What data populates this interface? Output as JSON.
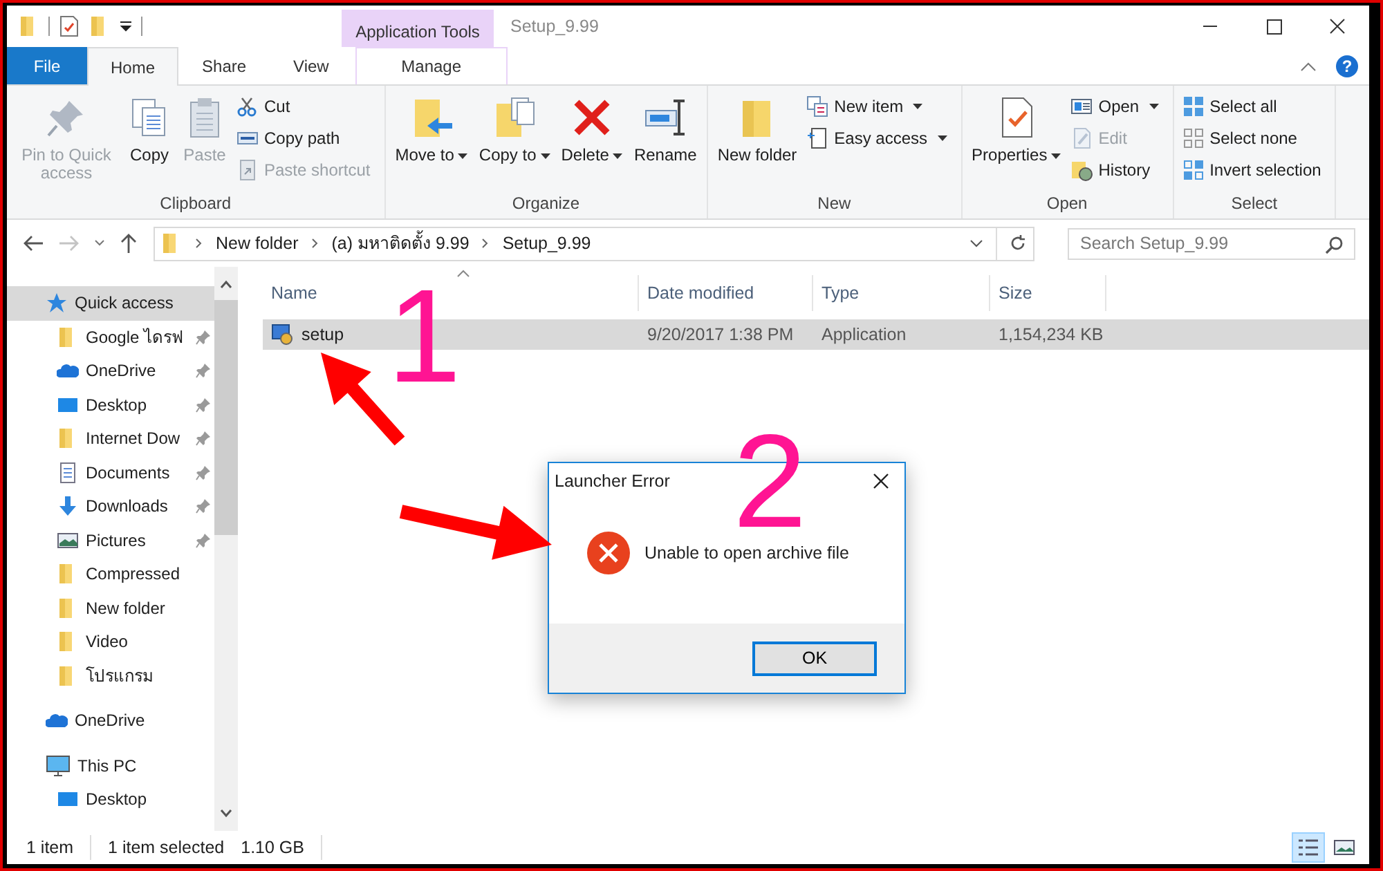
{
  "title_bar": {
    "contextual_tab": "Application Tools",
    "title": "Setup_9.99"
  },
  "ribbon_tabs": [
    {
      "label": "File",
      "kind": "file",
      "selected": false
    },
    {
      "label": "Home",
      "kind": "tab",
      "selected": true
    },
    {
      "label": "Share",
      "kind": "tab",
      "selected": false
    },
    {
      "label": "View",
      "kind": "tab",
      "selected": false
    },
    {
      "label": "Manage",
      "kind": "contextual",
      "selected": false
    }
  ],
  "help": "?",
  "ribbon_groups": [
    {
      "label": "Clipboard",
      "items": [
        {
          "label": "Pin to Quick access",
          "kind": "large",
          "disabled": true,
          "dropdown": false
        },
        {
          "label": "Copy",
          "kind": "large",
          "disabled": false,
          "dropdown": false
        },
        {
          "label": "Paste",
          "kind": "large",
          "disabled": true,
          "dropdown": false
        },
        {
          "label": "Cut",
          "kind": "small",
          "disabled": false,
          "dropdown": false
        },
        {
          "label": "Copy path",
          "kind": "small",
          "disabled": false,
          "dropdown": false
        },
        {
          "label": "Paste shortcut",
          "kind": "small",
          "disabled": true,
          "dropdown": false
        }
      ]
    },
    {
      "label": "Organize",
      "items": [
        {
          "label": "Move to",
          "kind": "large",
          "disabled": false,
          "dropdown": true
        },
        {
          "label": "Copy to",
          "kind": "large",
          "disabled": false,
          "dropdown": true
        },
        {
          "label": "Delete",
          "kind": "large",
          "disabled": false,
          "dropdown": true
        },
        {
          "label": "Rename",
          "kind": "large",
          "disabled": false,
          "dropdown": false
        }
      ]
    },
    {
      "label": "New",
      "items": [
        {
          "label": "New folder",
          "kind": "large",
          "disabled": false,
          "dropdown": false
        },
        {
          "label": "New item",
          "kind": "small",
          "disabled": false,
          "dropdown": true
        },
        {
          "label": "Easy access",
          "kind": "small",
          "disabled": false,
          "dropdown": true
        }
      ]
    },
    {
      "label": "Open",
      "items": [
        {
          "label": "Properties",
          "kind": "large",
          "disabled": false,
          "dropdown": true
        },
        {
          "label": "Open",
          "kind": "small",
          "disabled": false,
          "dropdown": true
        },
        {
          "label": "Edit",
          "kind": "small",
          "disabled": true,
          "dropdown": false
        },
        {
          "label": "History",
          "kind": "small",
          "disabled": false,
          "dropdown": false
        }
      ]
    },
    {
      "label": "Select",
      "items": [
        {
          "label": "Select all",
          "kind": "small",
          "disabled": false,
          "dropdown": false
        },
        {
          "label": "Select none",
          "kind": "small",
          "disabled": false,
          "dropdown": false
        },
        {
          "label": "Invert selection",
          "kind": "small",
          "disabled": false,
          "dropdown": false
        }
      ]
    }
  ],
  "navigation": {
    "forward_disabled": true
  },
  "address": {
    "crumbs": [
      "New folder",
      "(a) มหาติดตั้ง 9.99",
      "Setup_9.99"
    ],
    "search_placeholder": "Search Setup_9.99"
  },
  "sidebar": {
    "items": [
      {
        "label": "Quick access",
        "selected": true,
        "children": [
          {
            "label": "Google ไดรฟ",
            "pinned": true,
            "selected": false
          },
          {
            "label": "OneDrive",
            "pinned": true,
            "selected": false
          },
          {
            "label": "Desktop",
            "pinned": true,
            "selected": false
          },
          {
            "label": "Internet Dow",
            "pinned": true,
            "selected": false
          },
          {
            "label": "Documents",
            "pinned": true,
            "selected": false
          },
          {
            "label": "Downloads",
            "pinned": true,
            "selected": false
          },
          {
            "label": "Pictures",
            "pinned": true,
            "selected": false
          },
          {
            "label": "Compressed",
            "pinned": false,
            "selected": false
          },
          {
            "label": "New folder",
            "pinned": false,
            "selected": false
          },
          {
            "label": "Video",
            "pinned": false,
            "selected": false
          },
          {
            "label": "โปรแกรม",
            "pinned": false,
            "selected": false
          }
        ]
      },
      {
        "label": "OneDrive",
        "selected": false
      },
      {
        "label": "This PC",
        "selected": false,
        "children": [
          {
            "label": "Desktop",
            "pinned": false,
            "selected": false
          }
        ]
      }
    ]
  },
  "file_list": {
    "columns": [
      "Name",
      "Date modified",
      "Type",
      "Size"
    ],
    "rows": [
      {
        "name": "setup",
        "date_modified": "9/20/2017 1:38 PM",
        "type": "Application",
        "size": "1,154,234 KB",
        "selected": true
      }
    ]
  },
  "status_bar": {
    "item_count": "1 item",
    "selection": "1 item selected",
    "size": "1.10 GB"
  },
  "views": [
    {
      "kind": "details",
      "selected": true
    },
    {
      "kind": "large_icons",
      "selected": false
    }
  ],
  "dialog": {
    "title": "Launcher Error",
    "message": "Unable to open archive file",
    "button": "OK"
  },
  "annotations": [
    {
      "text": "1"
    },
    {
      "text": "2"
    }
  ]
}
